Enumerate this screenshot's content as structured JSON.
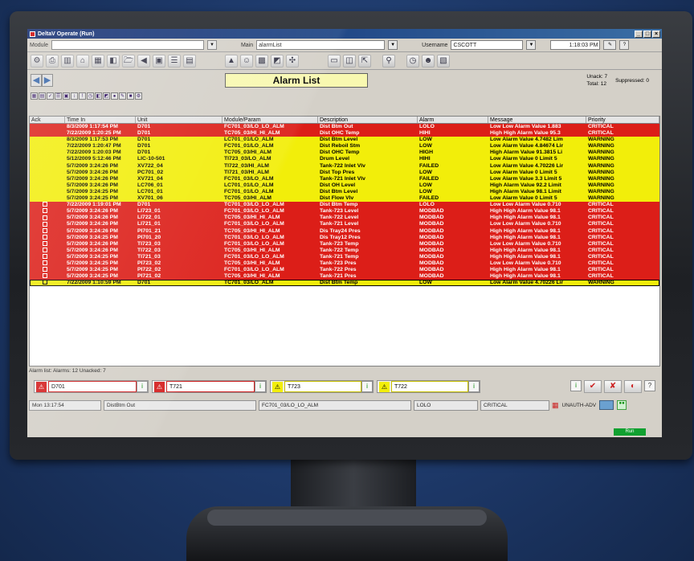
{
  "window": {
    "title": "DeltaV Operate (Run)",
    "controls": [
      "_",
      "□",
      "×"
    ]
  },
  "header_fields": {
    "module_label": "Module",
    "module_value": "",
    "main_label": "Main",
    "main_value": "alarmList",
    "username_label": "Username",
    "username_value": "CSCOTT",
    "time": "1:18:03 PM"
  },
  "alarm_header": {
    "title": "Alarm List",
    "unack_label": "Unack:",
    "unack_value": "7",
    "total_label": "Total:",
    "total_value": "12",
    "suppressed_label": "Suppressed:",
    "suppressed_value": "0"
  },
  "table": {
    "columns": [
      "Ack",
      "Time In",
      "Unit",
      "Module/Param",
      "Description",
      "Alarm",
      "Message",
      "Priority"
    ],
    "rows": [
      {
        "color": "red",
        "ack": false,
        "time": "8/3/2009 1:17:54 PM",
        "unit": "D701",
        "module": "FC701_03/LO_LO_ALM",
        "desc": "Dist Btm Out",
        "alarm": "LOLO",
        "msg": "Low Low Alarm Value 1.883",
        "pri": "CRITICAL"
      },
      {
        "color": "red",
        "ack": false,
        "time": "7/22/2009 1:20:25 PM",
        "unit": "D701",
        "module": "TC705_03/HI_HI_ALM",
        "desc": "Dist OHC Temp",
        "alarm": "HIHI",
        "msg": "High High Alarm Value 95.3",
        "pri": "CRITICAL"
      },
      {
        "color": "yel",
        "ack": false,
        "time": "8/3/2009 1:17:53 PM",
        "unit": "D701",
        "module": "LC701_01/LO_ALM",
        "desc": "Dist Btm Level",
        "alarm": "LOW",
        "msg": "Low Alarm Value 4.7482 Lim",
        "pri": "WARNING"
      },
      {
        "color": "yel",
        "ack": false,
        "time": "7/22/2009 1:20:47 PM",
        "unit": "D701",
        "module": "FC701_01/LO_ALM",
        "desc": "Dist Reboil Stm",
        "alarm": "LOW",
        "msg": "Low Alarm Value 4.84674 Lir",
        "pri": "WARNING"
      },
      {
        "color": "yel",
        "ack": false,
        "time": "7/22/2009 1:20:03 PM",
        "unit": "D701",
        "module": "TC705_03/HI_ALM",
        "desc": "Dist OHC Temp",
        "alarm": "HIGH",
        "msg": "High Alarm Value 91.3815 Li",
        "pri": "WARNING"
      },
      {
        "color": "yel",
        "ack": false,
        "time": "5/12/2009 5:12:46 PM",
        "unit": "LIC-10-501",
        "module": "TI723_03/LO_ALM",
        "desc": "Drum Level",
        "alarm": "HIHI",
        "msg": "Low Alarm Value 0 Limit 5",
        "pri": "WARNING"
      },
      {
        "color": "yel",
        "ack": false,
        "time": "5/7/2009 3:24:26 PM",
        "unit": "XV722_04",
        "module": "TI722_03/HI_ALM",
        "desc": "Tank-722 Inlet Vlv",
        "alarm": "FAILED",
        "msg": "Low Alarm Value 4.70226 Lir",
        "pri": "WARNING"
      },
      {
        "color": "yel",
        "ack": false,
        "time": "5/7/2009 3:24:26 PM",
        "unit": "PC701_02",
        "module": "TI721_03/HI_ALM",
        "desc": "Dist Top Pres",
        "alarm": "LOW",
        "msg": "Low Alarm Value 0 Limit 5",
        "pri": "WARNING"
      },
      {
        "color": "yel",
        "ack": false,
        "time": "5/7/2009 3:24:26 PM",
        "unit": "XV721_04",
        "module": "FC701_03/LO_ALM",
        "desc": "Tank-721 Inlet Vlv",
        "alarm": "FAILED",
        "msg": "Low Alarm Value 3.3 Limit 5",
        "pri": "WARNING"
      },
      {
        "color": "yel",
        "ack": false,
        "time": "5/7/2009 3:24:26 PM",
        "unit": "LC706_01",
        "module": "LC701_01/LO_ALM",
        "desc": "Dist OH Level",
        "alarm": "LOW",
        "msg": "High Alarm Value 92.2 Limit",
        "pri": "WARNING"
      },
      {
        "color": "yel",
        "ack": false,
        "time": "5/7/2009 3:24:25 PM",
        "unit": "LC701_01",
        "module": "FC701_01/LO_ALM",
        "desc": "Dist Btm Level",
        "alarm": "LOW",
        "msg": "High Alarm Value 98.1 Limit",
        "pri": "WARNING"
      },
      {
        "color": "yel",
        "ack": false,
        "time": "5/7/2009 3:24:25 PM",
        "unit": "XV701_06",
        "module": "TC705_03/HI_ALM",
        "desc": "Dist Flow Vlv",
        "alarm": "FAILED",
        "msg": "Low Alarm Value 0 Limit 5",
        "pri": "WARNING"
      },
      {
        "color": "red",
        "ack": true,
        "time": "7/22/2009 1:19:01 PM",
        "unit": "D701",
        "module": "TC701_03/LO_LO_ALM",
        "desc": "Dist Btm Temp",
        "alarm": "LOLO",
        "msg": "Low Low Alarm Value 0.710",
        "pri": "CRITICAL"
      },
      {
        "color": "red",
        "ack": true,
        "time": "5/7/2009 3:24:26 PM",
        "unit": "LI723_01",
        "module": "FC701_03/LO_LO_ALM",
        "desc": "Tank-723 Level",
        "alarm": "MODBAD",
        "msg": "High High Alarm Value 98.1",
        "pri": "CRITICAL"
      },
      {
        "color": "red",
        "ack": true,
        "time": "5/7/2009 3:24:26 PM",
        "unit": "LI722_01",
        "module": "TC705_03/HI_HI_ALM",
        "desc": "Tank-722 Level",
        "alarm": "MODBAD",
        "msg": "High High Alarm Value 98.1",
        "pri": "CRITICAL"
      },
      {
        "color": "red",
        "ack": true,
        "time": "5/7/2009 3:24:26 PM",
        "unit": "LI721_01",
        "module": "FC701_03/LO_LO_ALM",
        "desc": "Tank-721 Level",
        "alarm": "MODBAD",
        "msg": "Low Low Alarm Value 0.710",
        "pri": "CRITICAL"
      },
      {
        "color": "red",
        "ack": true,
        "time": "5/7/2009 3:24:26 PM",
        "unit": "PI701_21",
        "module": "TC705_03/HI_HI_ALM",
        "desc": "Dis Tray24 Pres",
        "alarm": "MODBAD",
        "msg": "High High Alarm Value 98.1",
        "pri": "CRITICAL"
      },
      {
        "color": "red",
        "ack": true,
        "time": "5/7/2009 3:24:25 PM",
        "unit": "PI701_20",
        "module": "TC701_03/LO_LO_ALM",
        "desc": "Dis Tray12 Pres",
        "alarm": "MODBAD",
        "msg": "High High Alarm Value 98.1",
        "pri": "CRITICAL"
      },
      {
        "color": "red",
        "ack": true,
        "time": "5/7/2009 3:24:26 PM",
        "unit": "TI723_03",
        "module": "FC701_03/LO_LO_ALM",
        "desc": "Tank-723 Temp",
        "alarm": "MODBAD",
        "msg": "Low Low Alarm Value 0.710",
        "pri": "CRITICAL"
      },
      {
        "color": "red",
        "ack": true,
        "time": "5/7/2009 3:24:26 PM",
        "unit": "TI722_03",
        "module": "TC705_03/HI_HI_ALM",
        "desc": "Tank-722 Temp",
        "alarm": "MODBAD",
        "msg": "High High Alarm Value 98.1",
        "pri": "CRITICAL"
      },
      {
        "color": "red",
        "ack": true,
        "time": "5/7/2009 3:24:25 PM",
        "unit": "TI721_03",
        "module": "FC701_03/LO_LO_ALM",
        "desc": "Tank-721 Temp",
        "alarm": "MODBAD",
        "msg": "High High Alarm Value 98.1",
        "pri": "CRITICAL"
      },
      {
        "color": "red",
        "ack": true,
        "time": "5/7/2009 3:24:25 PM",
        "unit": "PI723_02",
        "module": "TC705_03/HI_HI_ALM",
        "desc": "Tank-723 Pres",
        "alarm": "MODBAD",
        "msg": "Low Low Alarm Value 0.710",
        "pri": "CRITICAL"
      },
      {
        "color": "red",
        "ack": true,
        "time": "5/7/2009 3:24:25 PM",
        "unit": "PI722_02",
        "module": "FC701_03/LO_LO_ALM",
        "desc": "Tank-722 Pres",
        "alarm": "MODBAD",
        "msg": "High High Alarm Value 98.1",
        "pri": "CRITICAL"
      },
      {
        "color": "red",
        "ack": true,
        "time": "5/7/2009 3:24:25 PM",
        "unit": "PI721_02",
        "module": "TC705_03/HI_HI_ALM",
        "desc": "Tank-721 Pres",
        "alarm": "MODBAD",
        "msg": "High High Alarm Value 98.1",
        "pri": "CRITICAL"
      },
      {
        "color": "yel",
        "ack": true,
        "selected": true,
        "time": "7/22/2009 1:10:59 PM",
        "unit": "D701",
        "module": "TC701_03/LO_ALM",
        "desc": "Dist Btm Temp",
        "alarm": "LOW",
        "msg": "Low Alarm Value 4.70226 Lir",
        "pri": "WARNING"
      }
    ]
  },
  "status_line": "Alarm list: Alarms: 12  Unacked: 7",
  "banner": [
    {
      "name": "D701",
      "color": "red",
      "icon": "alarm-bell-icon"
    },
    {
      "name": "T721",
      "color": "red",
      "icon": "alarm-bell-icon"
    },
    {
      "name": "T723",
      "color": "yel",
      "icon": "warning-icon"
    },
    {
      "name": "T722",
      "color": "yel",
      "icon": "warning-icon"
    }
  ],
  "bottom_bar": {
    "time": "Mon 13:17:54",
    "desc": "DistBtm Out",
    "module": "FC701_03/LO_LO_ALM",
    "alarm": "LOLO",
    "priority": "CRITICAL",
    "user": "UNAUTH-ADV",
    "run": "Run"
  },
  "colors": {
    "critical": "#dc1e18",
    "warning": "#f2ee0a",
    "title_bar": "#0a246a"
  }
}
